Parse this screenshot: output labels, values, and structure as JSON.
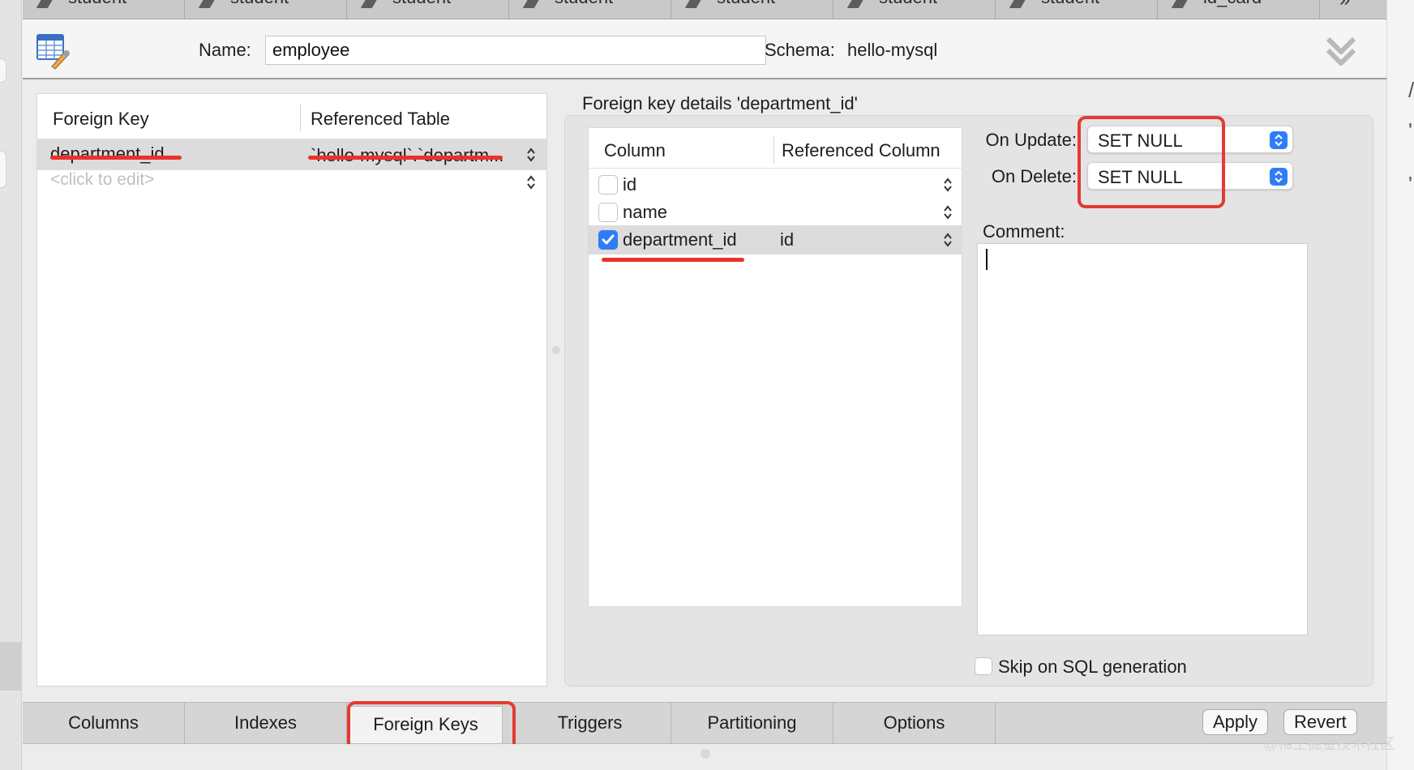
{
  "top_tabs": [
    "student",
    "student",
    "student",
    "student",
    "student",
    "student",
    "student",
    "id_card"
  ],
  "header": {
    "name_label": "Name:",
    "name_value": "employee",
    "schema_label": "Schema:",
    "schema_value": "hello-mysql"
  },
  "fk_list": {
    "col_fk": "Foreign Key",
    "col_table": "Referenced Table",
    "rows": [
      {
        "fk": "department_id",
        "table": "`hello-mysql`.`departm..."
      }
    ],
    "placeholder": "<click to edit>"
  },
  "details": {
    "title": "Foreign key details 'department_id'",
    "col_column": "Column",
    "col_ref": "Referenced Column",
    "columns": [
      {
        "name": "id",
        "checked": false,
        "ref": ""
      },
      {
        "name": "name",
        "checked": false,
        "ref": ""
      },
      {
        "name": "department_id",
        "checked": true,
        "ref": "id"
      }
    ],
    "on_update_label": "On Update:",
    "on_update_value": "SET NULL",
    "on_delete_label": "On Delete:",
    "on_delete_value": "SET NULL",
    "comment_label": "Comment:",
    "skip_label": "Skip on SQL generation"
  },
  "bottom_tabs": [
    "Columns",
    "Indexes",
    "Foreign Keys",
    "Triggers",
    "Partitioning",
    "Options"
  ],
  "active_tab": "Foreign Keys",
  "buttons": {
    "apply": "Apply",
    "revert": "Revert"
  },
  "watermark": "@稀土掘金技术社区",
  "colors": {
    "accent": "#2f7df6",
    "annotation_red": "#e33b30"
  }
}
